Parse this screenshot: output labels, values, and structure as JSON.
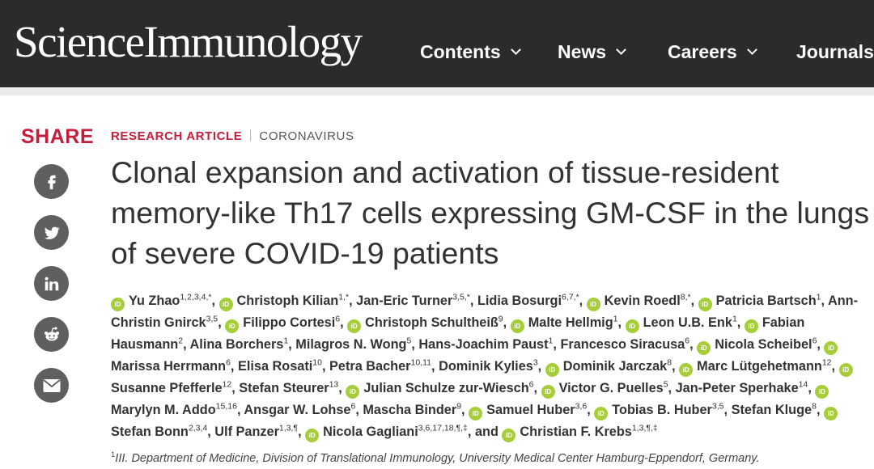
{
  "header": {
    "logo": "ScienceImmunology",
    "nav": [
      {
        "label": "Contents"
      },
      {
        "label": "News"
      },
      {
        "label": "Careers"
      },
      {
        "label": "Journals"
      }
    ]
  },
  "share": {
    "label": "SHARE",
    "buttons": [
      {
        "icon": "facebook-icon",
        "glyph": "f"
      },
      {
        "icon": "twitter-icon",
        "glyph": "🐦"
      },
      {
        "icon": "linkedin-icon",
        "glyph": "in"
      },
      {
        "icon": "reddit-icon",
        "glyph": "👽"
      },
      {
        "icon": "email-icon",
        "glyph": "✉"
      }
    ]
  },
  "article": {
    "type": "RESEARCH ARTICLE",
    "topic": "CORONAVIRUS",
    "title": "Clonal expansion and activation of tissue-resident memory-like Th17 cells expressing GM-CSF in the lungs of severe COVID-19 patients",
    "orcid_label": "iD",
    "authors": [
      {
        "name": "Yu Zhao",
        "sup": "1,2,3,4,*",
        "orcid": true
      },
      {
        "name": "Christoph Kilian",
        "sup": "1,*",
        "orcid": true
      },
      {
        "name": "Jan-Eric Turner",
        "sup": "3,5,*",
        "orcid": false
      },
      {
        "name": "Lidia Bosurgi",
        "sup": "6,7,*",
        "orcid": false
      },
      {
        "name": "Kevin Roedl",
        "sup": "8,*",
        "orcid": true
      },
      {
        "name": "Patricia Bartsch",
        "sup": "1",
        "orcid": true
      },
      {
        "name": "Ann-Christin Gnirck",
        "sup": "3,5",
        "orcid": false
      },
      {
        "name": "Filippo Cortesi",
        "sup": "6",
        "orcid": true
      },
      {
        "name": "Christoph Schultheiß",
        "sup": "9",
        "orcid": true
      },
      {
        "name": "Malte Hellmig",
        "sup": "1",
        "orcid": true
      },
      {
        "name": "Leon U.B. Enk",
        "sup": "1",
        "orcid": true
      },
      {
        "name": "Fabian Hausmann",
        "sup": "2",
        "orcid": true
      },
      {
        "name": "Alina Borchers",
        "sup": "1",
        "orcid": false
      },
      {
        "name": "Milagros N. Wong",
        "sup": "5",
        "orcid": false
      },
      {
        "name": "Hans-Joachim Paust",
        "sup": "1",
        "orcid": false
      },
      {
        "name": "Francesco Siracusa",
        "sup": "6",
        "orcid": false
      },
      {
        "name": "Nicola Scheibel",
        "sup": "6",
        "orcid": true
      },
      {
        "name": "Marissa Herrmann",
        "sup": "6",
        "orcid": true
      },
      {
        "name": "Elisa Rosati",
        "sup": "10",
        "orcid": false
      },
      {
        "name": "Petra Bacher",
        "sup": "10,11",
        "orcid": false
      },
      {
        "name": "Dominik Kylies",
        "sup": "3",
        "orcid": false
      },
      {
        "name": "Dominik Jarczak",
        "sup": "8",
        "orcid": true
      },
      {
        "name": "Marc Lütgehetmann",
        "sup": "12",
        "orcid": true
      },
      {
        "name": "Susanne Pfefferle",
        "sup": "12",
        "orcid": true
      },
      {
        "name": "Stefan Steurer",
        "sup": "13",
        "orcid": false
      },
      {
        "name": "Julian Schulze zur-Wiesch",
        "sup": "6",
        "orcid": true
      },
      {
        "name": "Victor G. Puelles",
        "sup": "5",
        "orcid": true
      },
      {
        "name": "Jan-Peter Sperhake",
        "sup": "14",
        "orcid": false
      },
      {
        "name": "Marylyn M. Addo",
        "sup": "15,16",
        "orcid": true
      },
      {
        "name": "Ansgar W. Lohse",
        "sup": "6",
        "orcid": false
      },
      {
        "name": "Mascha Binder",
        "sup": "9",
        "orcid": false
      },
      {
        "name": "Samuel Huber",
        "sup": "3,6",
        "orcid": true
      },
      {
        "name": "Tobias B. Huber",
        "sup": "3,5",
        "orcid": true
      },
      {
        "name": "Stefan Kluge",
        "sup": "8",
        "orcid": false
      },
      {
        "name": "Stefan Bonn",
        "sup": "2,3,4",
        "orcid": true
      },
      {
        "name": "Ulf Panzer",
        "sup": "1,3,¶",
        "orcid": false
      },
      {
        "name": "Nicola Gagliani",
        "sup": "3,6,17,18,¶,‡",
        "orcid": true
      },
      {
        "name": "Christian F. Krebs",
        "sup": "1,3,¶,‡",
        "orcid": true
      }
    ],
    "and_word": "and",
    "affiliation": {
      "sup": "1",
      "text": "III. Department of Medicine, Division of Translational Immunology, University Medical Center Hamburg-Eppendorf, Germany."
    }
  }
}
